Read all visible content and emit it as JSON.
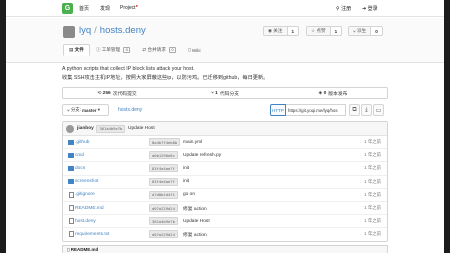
{
  "nav": {
    "home": "首页",
    "explore": "发现",
    "project": "Project",
    "register": "注册",
    "login": "登录"
  },
  "repo": {
    "owner": "lyq",
    "name": "hosts.deny"
  },
  "actions": [
    {
      "label": "关注",
      "count": "1"
    },
    {
      "label": "点赞",
      "count": "1"
    },
    {
      "label": "派生",
      "count": "0"
    }
  ],
  "tabs": [
    {
      "label": "文件",
      "count": ""
    },
    {
      "label": "工单管理",
      "count": "0"
    },
    {
      "label": "合并请求",
      "count": "0"
    },
    {
      "label": "Wiki",
      "count": ""
    }
  ],
  "description": {
    "line1": "A python scripts that collect IP block lists attack your host.",
    "line2": "收集 SSH攻击主机IP地址，按照大家屏蔽这些ip，以防污鸡。已迁移到github，每日更新。"
  },
  "stats": [
    {
      "value": "256",
      "label": "次代码提交"
    },
    {
      "value": "1",
      "label": "代码分支"
    },
    {
      "value": "0",
      "label": "版本发布"
    }
  ],
  "toolbar": {
    "branch_label": "分支:",
    "branch": "master",
    "crumb": "hosts.deny",
    "protocol": "HTTP",
    "clone_url": "https://git.yoqi.me/lyq/hos"
  },
  "latest_commit": {
    "author": "jianboy",
    "sha": "361a4b9e7b",
    "message": "Update Host"
  },
  "files": [
    {
      "type": "folder",
      "name": ".github",
      "sha": "8a4b7f4eb8b",
      "message": "main.yml",
      "time": "1 年之前"
    },
    {
      "type": "folder",
      "name": "cmd",
      "sha": "a0b1290e8c",
      "message": "Update refresh.py",
      "time": "1 年之前"
    },
    {
      "type": "folder",
      "name": "docs",
      "sha": "83f4e4ae7f",
      "message": "init",
      "time": "1 年之前"
    },
    {
      "type": "folder",
      "name": "screenshot",
      "sha": "83f4e4ae7f",
      "message": "init",
      "time": "1 年之前"
    },
    {
      "type": "file",
      "name": ".gitignore",
      "sha": "a7d0b1d4f1",
      "message": "go on",
      "time": "1 年之前"
    },
    {
      "type": "file",
      "name": "README.md",
      "sha": "d07a229d24",
      "message": "修复 action",
      "time": "1 年之前"
    },
    {
      "type": "file",
      "name": "host.deny",
      "sha": "361a4b9e7b",
      "message": "Update Host",
      "time": "1 年之前"
    },
    {
      "type": "file",
      "name": "requirements.txt",
      "sha": "d07a229d24",
      "message": "修复 action",
      "time": "1 年之前"
    }
  ],
  "readme_title": "README.md",
  "colors": {
    "link": "#4183c4",
    "logo": "#4caf50",
    "edge": "#1b1c1d"
  }
}
